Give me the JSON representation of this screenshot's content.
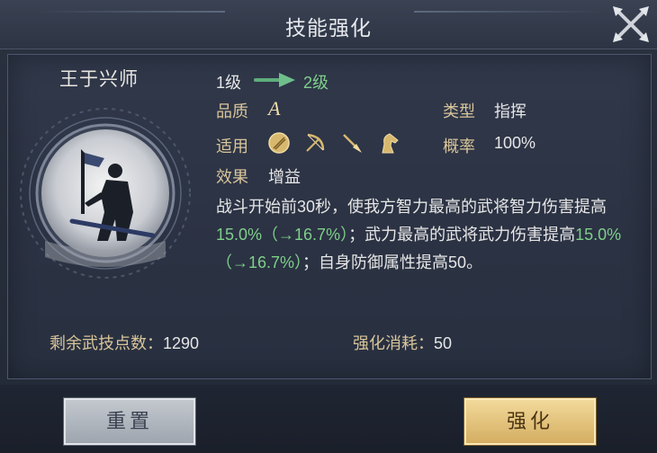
{
  "window": {
    "title": "技能强化"
  },
  "hero": {
    "name": "王于兴师"
  },
  "level": {
    "from": "1级",
    "to": "2级"
  },
  "info": {
    "quality_label": "品质",
    "quality_value": "A",
    "type_label": "类型",
    "type_value": "指挥",
    "applicable_label": "适用",
    "applicable_icons": [
      "shield-icon",
      "bow-icon",
      "spear-icon",
      "horse-icon"
    ],
    "rate_label": "概率",
    "rate_value": "100%",
    "effect_label": "效果",
    "effect_value": "增益"
  },
  "description": {
    "part1": "战斗开始前30秒，使我方智力最高的武将智力伤害提高",
    "value1": "15.0%（→16.7%）",
    "part2": "；武力最高的武将武力伤害提高",
    "value2": "15.0%（→16.7%）",
    "part3": "；自身防御属性提高50。"
  },
  "footer": {
    "points_label": "剩余武技点数：",
    "points_value": "1290",
    "cost_label": "强化消耗：",
    "cost_value": "50"
  },
  "buttons": {
    "reset": "重置",
    "enhance": "强化"
  },
  "colors": {
    "accent_gold": "#d9c59a",
    "value_green": "#7fcf8a",
    "arrow_green": "#5fae7c"
  }
}
